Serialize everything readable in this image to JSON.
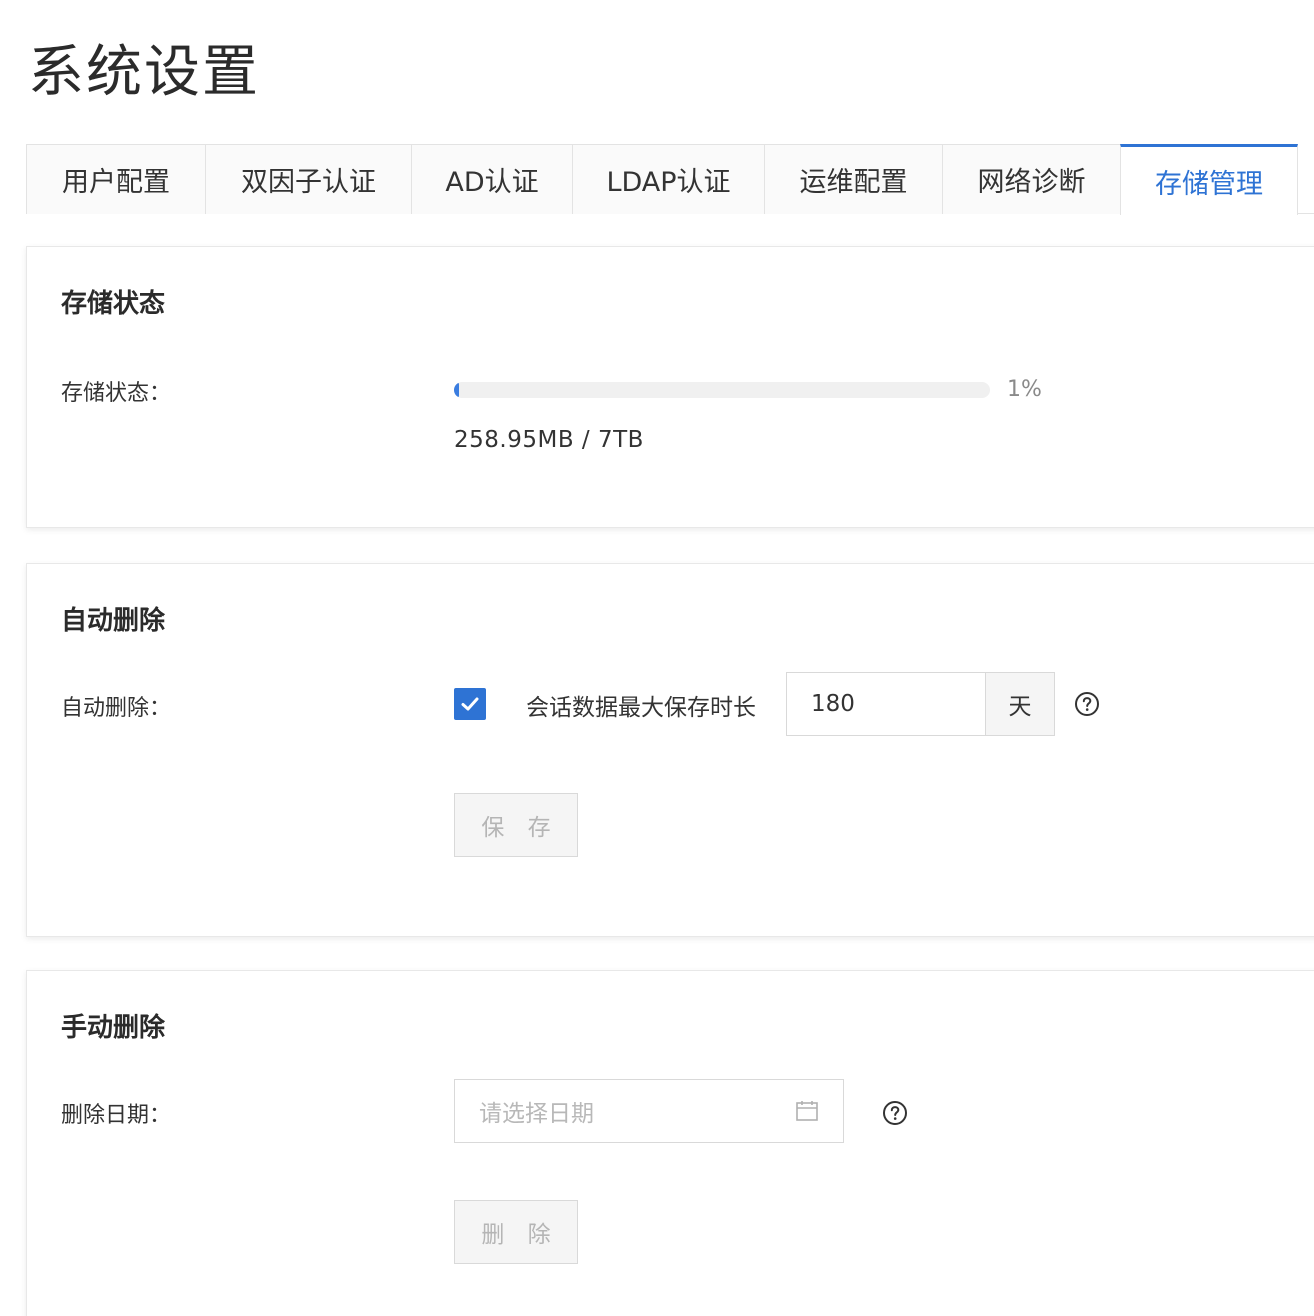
{
  "page": {
    "title": "系统设置"
  },
  "tabs": [
    {
      "label": "用户配置",
      "active": false
    },
    {
      "label": "双因子认证",
      "active": false
    },
    {
      "label": "AD认证",
      "active": false
    },
    {
      "label": "LDAP认证",
      "active": false
    },
    {
      "label": "运维配置",
      "active": false
    },
    {
      "label": "网络诊断",
      "active": false
    },
    {
      "label": "存储管理",
      "active": true
    }
  ],
  "storage_status": {
    "title": "存储状态",
    "label": "存储状态：",
    "progress_percent": 1,
    "progress_text": "1%",
    "usage": "258.95MB / 7TB"
  },
  "auto_delete": {
    "title": "自动删除",
    "label": "自动删除：",
    "checked": true,
    "description": "会话数据最大保存时长",
    "value": "180",
    "unit": "天",
    "save_label": "保 存"
  },
  "manual_delete": {
    "title": "手动删除",
    "label": "删除日期：",
    "date_placeholder": "请选择日期",
    "delete_label": "删 除"
  },
  "colors": {
    "accent": "#2e73d4",
    "progress": "#3a7de0",
    "disabled_text": "#b5b5b5"
  },
  "icons": {
    "help": "question-circle-icon",
    "calendar": "calendar-icon",
    "check": "check-icon"
  }
}
